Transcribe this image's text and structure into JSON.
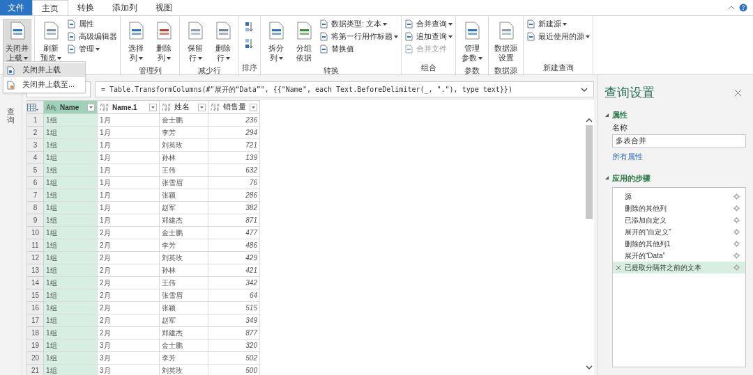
{
  "file_button": "文件",
  "tabs": [
    {
      "label": "主页",
      "selected": true
    },
    {
      "label": "转换",
      "selected": false
    },
    {
      "label": "添加列",
      "selected": false
    },
    {
      "label": "视图",
      "selected": false
    }
  ],
  "ribbon": [
    {
      "items": [
        {
          "kind": "large",
          "lines": [
            "关闭并",
            "上载"
          ],
          "dropdown": true,
          "selected": true
        }
      ]
    },
    {
      "items": [
        {
          "kind": "large",
          "lines": [
            "刷新",
            "预览"
          ],
          "dropdown": true,
          "selected": false
        },
        {
          "kind": "stack",
          "children": [
            {
              "label": "属性",
              "dropdown": false,
              "disabled": false
            },
            {
              "label": "高级编辑器",
              "dropdown": false,
              "disabled": false
            },
            {
              "label": "管理",
              "dropdown": true,
              "disabled": false
            }
          ]
        }
      ]
    },
    {
      "label": "管理列",
      "items": [
        {
          "kind": "large",
          "lines": [
            "选择",
            "列"
          ],
          "dropdown": true,
          "selected": false
        },
        {
          "kind": "large",
          "lines": [
            "删除",
            "列"
          ],
          "dropdown": true,
          "selected": false
        }
      ]
    },
    {
      "label": "减少行",
      "items": [
        {
          "kind": "large",
          "lines": [
            "保留",
            "行"
          ],
          "dropdown": true,
          "selected": false
        },
        {
          "kind": "large",
          "lines": [
            "删除",
            "行"
          ],
          "dropdown": true,
          "selected": false
        }
      ]
    },
    {
      "label": "排序",
      "items": [
        {
          "kind": "sort"
        }
      ]
    },
    {
      "label": "转换",
      "items": [
        {
          "kind": "large",
          "lines": [
            "拆分",
            "列"
          ],
          "dropdown": true,
          "selected": false
        },
        {
          "kind": "large",
          "lines": [
            "分组",
            "依据"
          ],
          "dropdown": false,
          "selected": false
        },
        {
          "kind": "stack",
          "children": [
            {
              "label": "数据类型: 文本",
              "dropdown": true,
              "disabled": false
            },
            {
              "label": "将第一行用作标题",
              "dropdown": true,
              "disabled": false
            },
            {
              "label": "替换值",
              "dropdown": false,
              "disabled": false
            }
          ]
        }
      ]
    },
    {
      "label": "组合",
      "items": [
        {
          "kind": "stack",
          "children": [
            {
              "label": "合并查询",
              "dropdown": true,
              "disabled": false
            },
            {
              "label": "追加查询",
              "dropdown": true,
              "disabled": false
            },
            {
              "label": "合并文件",
              "dropdown": false,
              "disabled": true
            }
          ]
        }
      ]
    },
    {
      "label": "参数",
      "items": [
        {
          "kind": "large",
          "lines": [
            "管理",
            "参数"
          ],
          "dropdown": true,
          "selected": false
        }
      ]
    },
    {
      "label": "数据源",
      "items": [
        {
          "kind": "large",
          "lines": [
            "数据源",
            "设置"
          ],
          "dropdown": false,
          "selected": false
        }
      ]
    },
    {
      "label": "新建查询",
      "items": [
        {
          "kind": "stack",
          "children": [
            {
              "label": "新建源",
              "dropdown": true,
              "disabled": false
            },
            {
              "label": "最近使用的源",
              "dropdown": true,
              "disabled": false
            }
          ]
        }
      ]
    }
  ],
  "menu": [
    {
      "label": "关闭并上载",
      "selected": true
    },
    {
      "label": "关闭并上载至...",
      "selected": false
    }
  ],
  "nav_label": "查询",
  "formula": "= Table.TransformColumns(#\"展开的“Data”\", {{\"Name\", each Text.BeforeDelimiter(_, \".\"), type text}})",
  "table": {
    "columns": [
      {
        "name": "Name",
        "kind": "text",
        "selected": true
      },
      {
        "name": "Name.1",
        "kind": "any",
        "selected": false
      },
      {
        "name": "姓名",
        "kind": "any",
        "selected": false
      },
      {
        "name": "销售量",
        "kind": "any",
        "selected": false
      }
    ],
    "row_numbers": [
      "1",
      "2",
      "3",
      "4",
      "5",
      "6",
      "7",
      "8",
      "9",
      "10",
      "11",
      "12",
      "13",
      "14",
      "15",
      "16",
      "17",
      "18",
      "19",
      "20",
      "21"
    ],
    "rows": [
      [
        "1组",
        "1月",
        "金士鹏",
        "236"
      ],
      [
        "1组",
        "1月",
        "李芳",
        "294"
      ],
      [
        "1组",
        "1月",
        "刘英玫",
        "721"
      ],
      [
        "1组",
        "1月",
        "孙林",
        "139"
      ],
      [
        "1组",
        "1月",
        "王伟",
        "632"
      ],
      [
        "1组",
        "1月",
        "张雪眉",
        "76"
      ],
      [
        "1组",
        "1月",
        "张颖",
        "286"
      ],
      [
        "1组",
        "1月",
        "赵军",
        "382"
      ],
      [
        "1组",
        "1月",
        "郑建杰",
        "871"
      ],
      [
        "1组",
        "2月",
        "金士鹏",
        "477"
      ],
      [
        "1组",
        "2月",
        "李芳",
        "486"
      ],
      [
        "1组",
        "2月",
        "刘英玫",
        "429"
      ],
      [
        "1组",
        "2月",
        "孙林",
        "421"
      ],
      [
        "1组",
        "2月",
        "王伟",
        "342"
      ],
      [
        "1组",
        "2月",
        "张雪眉",
        "64"
      ],
      [
        "1组",
        "2月",
        "张颖",
        "515"
      ],
      [
        "1组",
        "2月",
        "赵军",
        "349"
      ],
      [
        "1组",
        "2月",
        "郑建杰",
        "877"
      ],
      [
        "1组",
        "3月",
        "金士鹏",
        "320"
      ],
      [
        "1组",
        "3月",
        "李芳",
        "502"
      ],
      [
        "1组",
        "3月",
        "刘英玫",
        "500"
      ]
    ]
  },
  "settings": {
    "title": "查询设置",
    "properties": {
      "heading": "属性",
      "expanded": true,
      "name_label": "名称",
      "name_value": "多表合并",
      "link": "所有属性"
    },
    "steps_heading": "应用的步骤",
    "steps_expanded": true,
    "steps": [
      {
        "label": "源",
        "selected": false
      },
      {
        "label": "删除的其他列",
        "selected": false
      },
      {
        "label": "已添加自定义",
        "selected": false
      },
      {
        "label": "展开的“自定义”",
        "selected": false
      },
      {
        "label": "删除的其他列1",
        "selected": false
      },
      {
        "label": "展开的“Data”",
        "selected": false
      },
      {
        "label": "已提取分隔符之前的文本",
        "selected": true
      }
    ]
  }
}
